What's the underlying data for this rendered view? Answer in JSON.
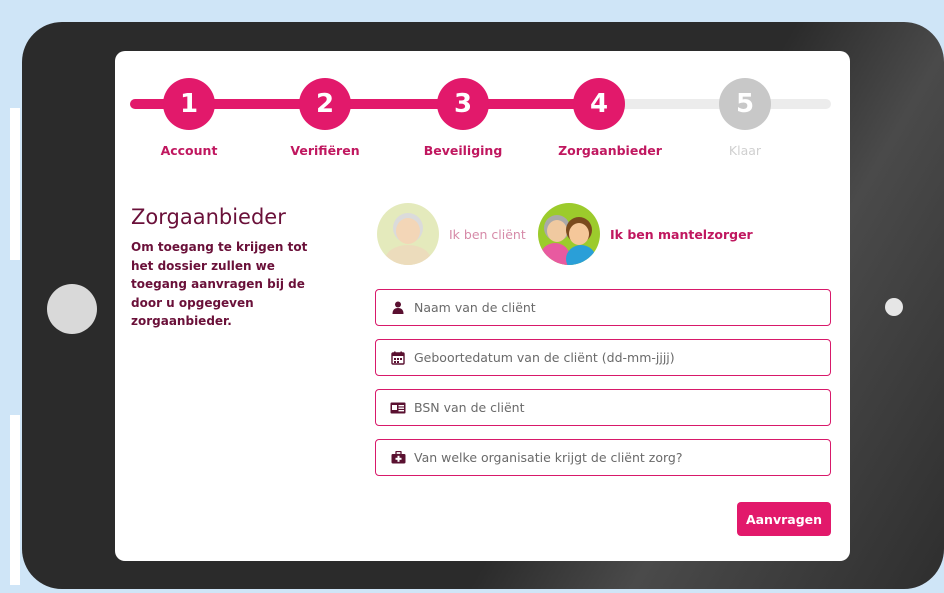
{
  "stepper": {
    "steps": [
      {
        "number": "1",
        "label": "Account",
        "state": "done"
      },
      {
        "number": "2",
        "label": "Verifiëren",
        "state": "done"
      },
      {
        "number": "3",
        "label": "Beveiliging",
        "state": "done"
      },
      {
        "number": "4",
        "label": "Zorgaanbieder",
        "state": "current"
      },
      {
        "number": "5",
        "label": "Klaar",
        "state": "todo"
      }
    ]
  },
  "intro": {
    "title": "Zorgaanbieder",
    "text": "Om toegang te krijgen tot het dossier zullen we toegang aanvragen bij de door u opgegeven zorgaanbieder."
  },
  "choices": {
    "client_label": "Ik ben cliënt",
    "carer_label": "Ik ben mantelzorger",
    "selected": "carer"
  },
  "form": {
    "name_placeholder": "Naam van de cliënt",
    "dob_placeholder": "Geboortedatum van de cliënt (dd-mm-jjjj)",
    "bsn_placeholder": "BSN van de cliënt",
    "org_placeholder": "Van welke organisatie krijgt de cliënt zorg?",
    "submit_label": "Aanvragen"
  },
  "colors": {
    "accent": "#e2196b",
    "text_dark": "#6a1039",
    "inactive": "#c8c8c8",
    "field_border": "#d8196a"
  },
  "icons": {
    "name": "user-icon",
    "dob": "calendar-icon",
    "bsn": "id-card-icon",
    "org": "medical-kit-icon"
  }
}
